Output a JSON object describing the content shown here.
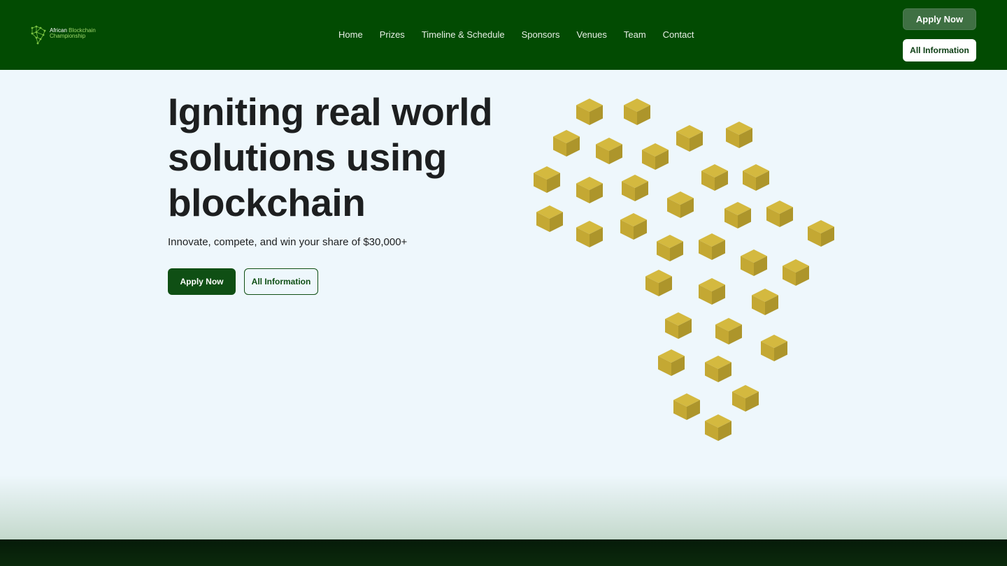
{
  "brand": {
    "name_part1": "African",
    "name_part2": "Blockchain",
    "name_line2": "Championship",
    "logo_icon": "africa-network-icon"
  },
  "nav": {
    "links": [
      "Home",
      "Prizes",
      "Timeline & Schedule",
      "Sponsors",
      "Venues",
      "Team",
      "Contact"
    ],
    "apply_label": "Apply Now",
    "info_label": "All Information"
  },
  "hero": {
    "title": "Igniting real world solutions using blockchain",
    "subtitle": "Innovate, compete, and win your share of $30,000+",
    "apply_label": "Apply Now",
    "info_label": "All Information",
    "illustration": "africa-cube-map"
  },
  "colors": {
    "nav_bg": "#024b02",
    "accent_green": "#0f4f14",
    "cube_gold": "#c9ad36",
    "page_bg": "#eef7fc"
  }
}
